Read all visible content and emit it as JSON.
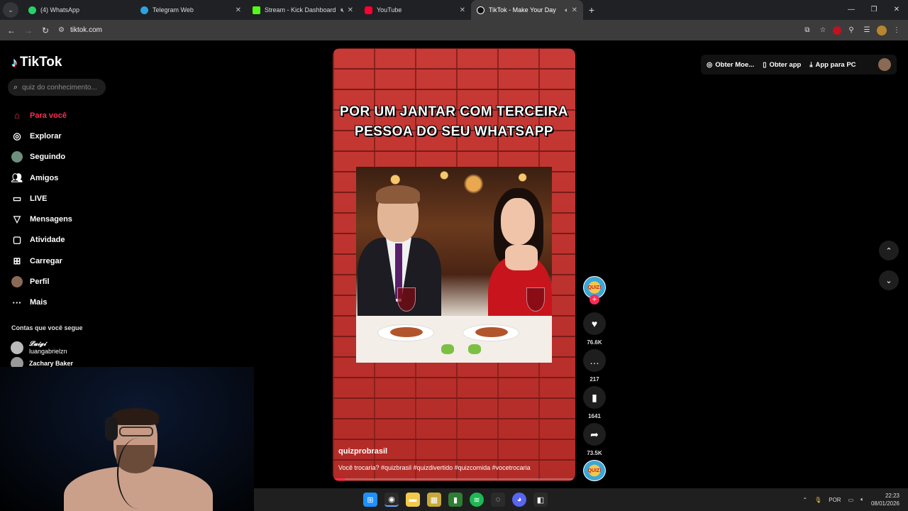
{
  "browser": {
    "tabs": [
      {
        "label": "(4) WhatsApp",
        "color": "#25d366",
        "active": false
      },
      {
        "label": "Telegram Web",
        "color": "#2aa3e0",
        "active": false
      },
      {
        "label": "Stream - Kick Dashboard",
        "color": "#53fc18",
        "active": false
      },
      {
        "label": "YouTube",
        "color": "#ff0033",
        "active": false
      },
      {
        "label": "TikTok - Make Your Day",
        "color": "#ffffff",
        "active": true
      }
    ],
    "url": "tiktok.com"
  },
  "sidebar": {
    "logo": "TikTok",
    "search_placeholder": "quiz do conhecimento...",
    "items": [
      {
        "label": "Para você",
        "icon": "home-icon",
        "active": true
      },
      {
        "label": "Explorar",
        "icon": "compass-icon"
      },
      {
        "label": "Seguindo",
        "icon": "following-avatar-icon"
      },
      {
        "label": "Amigos",
        "icon": "friends-icon"
      },
      {
        "label": "LIVE",
        "icon": "live-icon"
      },
      {
        "label": "Mensagens",
        "icon": "messages-icon"
      },
      {
        "label": "Atividade",
        "icon": "activity-icon"
      },
      {
        "label": "Carregar",
        "icon": "upload-icon"
      },
      {
        "label": "Perfil",
        "icon": "profile-avatar-icon"
      },
      {
        "label": "Mais",
        "icon": "more-icon"
      }
    ],
    "following_title": "Contas que você segue",
    "accounts": [
      {
        "display": "𝓛𝓾𝓲𝓰𝓲",
        "handle": "luangabrielzn"
      },
      {
        "display": "Zachary Baker",
        "handle": ""
      }
    ]
  },
  "header": {
    "coins": "Obter Moe...",
    "get_app": "Obter app",
    "pc_app": "App para PC"
  },
  "video": {
    "overlay_text": "POR UM JANTAR COM TERCEIRA PESSOA DO SEU WHATSAPP",
    "author": "quizprobrasil",
    "description": "Você trocaria? #quizbrasil #quizdivertido #quizcomida #vocetrocaria",
    "progress": 0.05,
    "creator_badge": "QUIZ!"
  },
  "actions": {
    "likes": "76.6K",
    "comments": "217",
    "saves": "1641",
    "shares": "73.5K"
  },
  "taskbar": {
    "lang": "POR",
    "time": "22:23",
    "date": "08/01/2026"
  }
}
